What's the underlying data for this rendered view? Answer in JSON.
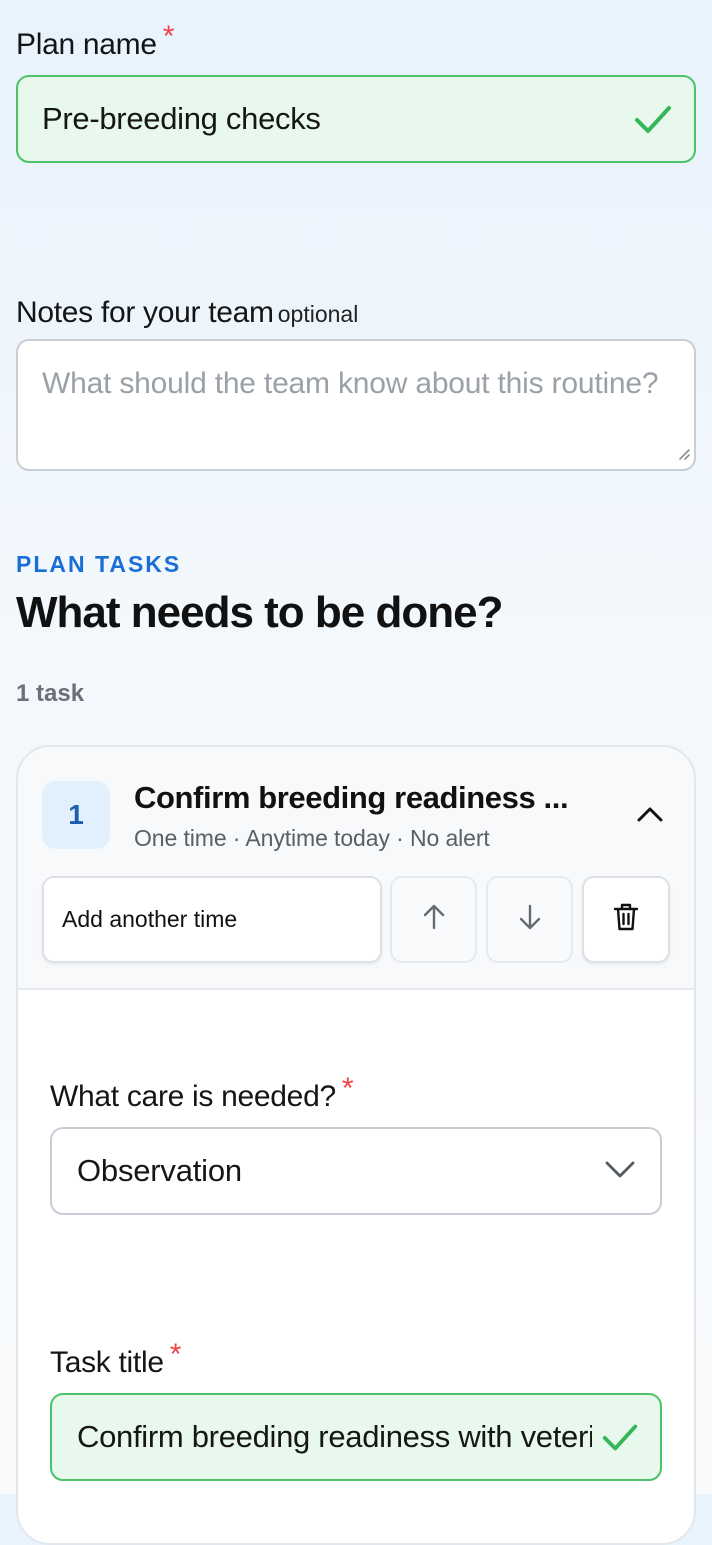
{
  "plan_name": {
    "label": "Plan name",
    "required_mark": "*",
    "value": "Pre-breeding checks"
  },
  "notes": {
    "label": "Notes for your team",
    "optional_label": "optional",
    "placeholder": "What should the team know about this routine?"
  },
  "tasks_section": {
    "eyebrow": "PLAN TASKS",
    "heading": "What needs to be done?",
    "count": "1 task"
  },
  "task": {
    "number": "1",
    "title": "Confirm breeding readiness ...",
    "meta": "One time · Anytime today · No alert",
    "add_time_label": "Add another time",
    "care": {
      "label": "What care is needed?",
      "required_mark": "*",
      "value": "Observation"
    },
    "title_field": {
      "label": "Task title",
      "required_mark": "*",
      "value": "Confirm breeding readiness with veterinarian"
    }
  },
  "colors": {
    "accent": "#1a6fd6",
    "success": "#4cc36a",
    "required": "#ef4444"
  },
  "icons": [
    "check-icon",
    "resize-handle-icon",
    "chevron-up-icon",
    "arrow-up-icon",
    "arrow-down-icon",
    "trash-icon",
    "chevron-down-icon"
  ]
}
